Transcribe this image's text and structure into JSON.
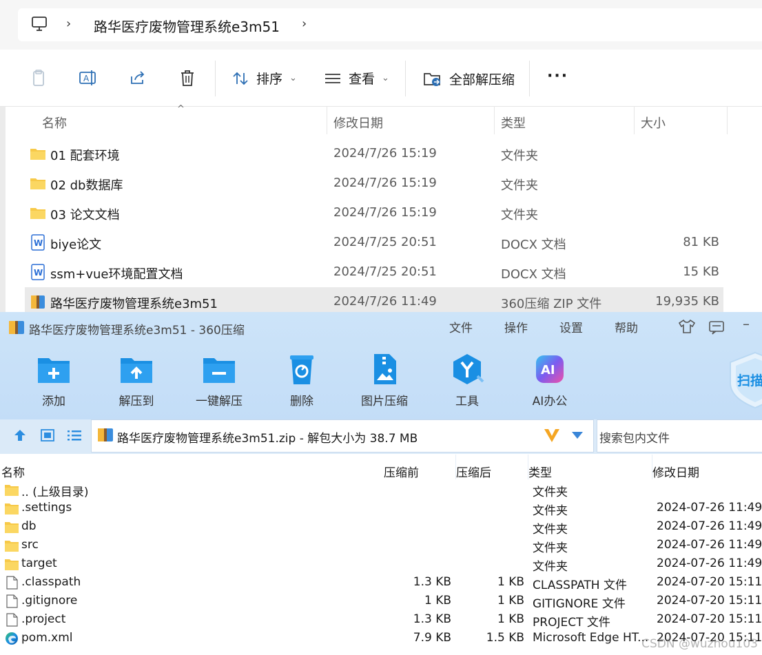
{
  "explorer": {
    "breadcrumb": [
      "路华医疗废物管理系统e3m51"
    ],
    "toolbar": {
      "sort_label": "排序",
      "view_label": "查看",
      "extract_all_label": "全部解压缩"
    },
    "columns": {
      "name": "名称",
      "date": "修改日期",
      "type": "类型",
      "size": "大小"
    },
    "files": [
      {
        "icon": "folder-icon",
        "name": "01 配套环境",
        "date": "2024/7/26 15:19",
        "type": "文件夹",
        "size": ""
      },
      {
        "icon": "folder-icon",
        "name": "02 db数据库",
        "date": "2024/7/26 15:19",
        "type": "文件夹",
        "size": ""
      },
      {
        "icon": "folder-icon",
        "name": "03 论文文档",
        "date": "2024/7/26 15:19",
        "type": "文件夹",
        "size": ""
      },
      {
        "icon": "word-doc-icon",
        "name": "biye论文",
        "date": "2024/7/25 20:51",
        "type": "DOCX 文档",
        "size": "81 KB"
      },
      {
        "icon": "word-doc-icon",
        "name": "ssm+vue环境配置文档",
        "date": "2024/7/25 20:51",
        "type": "DOCX 文档",
        "size": "15 KB"
      },
      {
        "icon": "zip-archive-icon",
        "name": "路华医疗废物管理系统e3m51",
        "date": "2024/7/26 11:49",
        "type": "360压缩 ZIP 文件",
        "size": "19,935 KB",
        "selected": true
      }
    ]
  },
  "zip_window": {
    "title": "路华医疗废物管理系统e3m51 - 360压缩",
    "menu": [
      "文件",
      "操作",
      "设置",
      "帮助"
    ],
    "tools": [
      {
        "icon": "add-icon",
        "label": "添加"
      },
      {
        "icon": "extract-to-icon",
        "label": "解压到"
      },
      {
        "icon": "one-click-extract-icon",
        "label": "一键解压"
      },
      {
        "icon": "delete-icon",
        "label": "删除"
      },
      {
        "icon": "image-compress-icon",
        "label": "图片压缩"
      },
      {
        "icon": "tools-icon",
        "label": "工具"
      },
      {
        "icon": "ai-office-icon",
        "label": "AI办公"
      }
    ],
    "scan_label": "扫描",
    "path": "路华医疗废物管理系统e3m51.zip - 解包大小为 38.7 MB",
    "search_placeholder": "搜索包内文件",
    "columns": {
      "name": "名称",
      "before": "压缩前",
      "after": "压缩后",
      "type": "类型",
      "date": "修改日期"
    },
    "entries": [
      {
        "icon": "folder-icon",
        "name": ".. (上级目录)",
        "before": "",
        "after": "",
        "type": "文件夹",
        "date": ""
      },
      {
        "icon": "folder-icon",
        "name": ".settings",
        "before": "",
        "after": "",
        "type": "文件夹",
        "date": "2024-07-26 11:49"
      },
      {
        "icon": "folder-icon",
        "name": "db",
        "before": "",
        "after": "",
        "type": "文件夹",
        "date": "2024-07-26 11:49"
      },
      {
        "icon": "folder-icon",
        "name": "src",
        "before": "",
        "after": "",
        "type": "文件夹",
        "date": "2024-07-26 11:49"
      },
      {
        "icon": "folder-icon",
        "name": "target",
        "before": "",
        "after": "",
        "type": "文件夹",
        "date": "2024-07-26 11:49"
      },
      {
        "icon": "file-icon",
        "name": ".classpath",
        "before": "1.3 KB",
        "after": "1 KB",
        "type": "CLASSPATH 文件",
        "date": "2024-07-20 15:11"
      },
      {
        "icon": "file-icon",
        "name": ".gitignore",
        "before": "1 KB",
        "after": "1 KB",
        "type": "GITIGNORE 文件",
        "date": "2024-07-20 15:11"
      },
      {
        "icon": "file-icon",
        "name": ".project",
        "before": "1.3 KB",
        "after": "1 KB",
        "type": "PROJECT 文件",
        "date": "2024-07-20 15:11"
      },
      {
        "icon": "edge-icon",
        "name": "pom.xml",
        "before": "7.9 KB",
        "after": "1.5 KB",
        "type": "Microsoft Edge HT...",
        "date": "2024-07-20 15:11"
      }
    ]
  },
  "watermark": "CSDN @wuzhou103",
  "colors": {
    "folder": "#f7c948",
    "accent_blue": "#1a8fe3",
    "zip_top": "#c8e0f8"
  }
}
